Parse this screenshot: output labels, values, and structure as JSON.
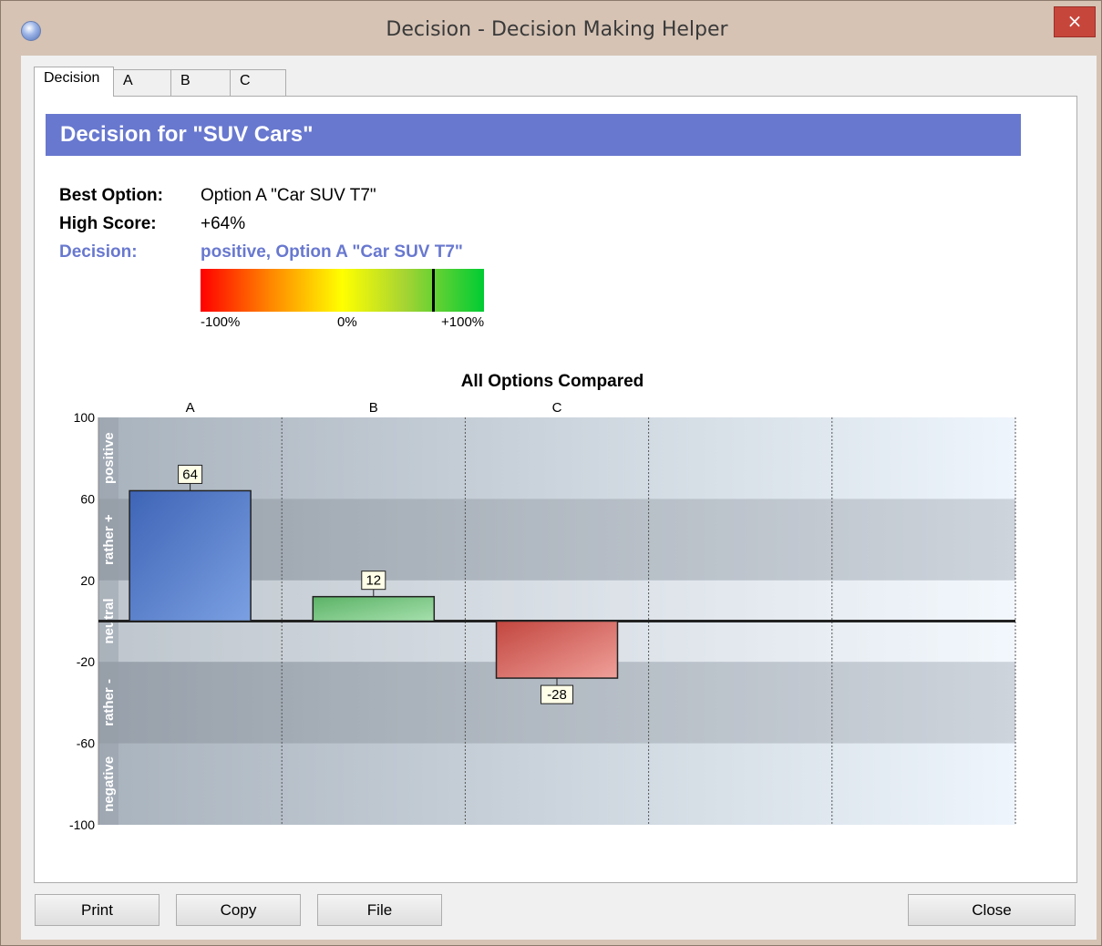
{
  "window": {
    "title": "Decision - Decision Making Helper",
    "close_glyph": "×"
  },
  "tabs": [
    {
      "label": "Decision"
    },
    {
      "label": "A"
    },
    {
      "label": "B"
    },
    {
      "label": "C"
    }
  ],
  "decision": {
    "banner": "Decision for  \"SUV Cars\"",
    "best_option_label": "Best Option:",
    "best_option_value": "Option A \"Car SUV T7\"",
    "high_score_label": "High Score:",
    "high_score_value": "+64%",
    "decision_label": "Decision:",
    "decision_value": "positive, Option A \"Car SUV T7\"",
    "gauge": {
      "value_percent": 64,
      "min_label": "-100%",
      "mid_label": "0%",
      "max_label": "+100%"
    }
  },
  "chart_data": {
    "type": "bar",
    "title": "All Options Compared",
    "categories": [
      "A",
      "B",
      "C"
    ],
    "values": [
      64,
      12,
      -28
    ],
    "data_labels": [
      "64",
      "12",
      "-28"
    ],
    "bar_colors": [
      "#4a72c4",
      "#6cc27a",
      "#d9605a"
    ],
    "ylim": [
      -100,
      100
    ],
    "yticks": [
      "100",
      "60",
      "20",
      "-20",
      "-60",
      "-100"
    ],
    "bands": [
      "positive",
      "rather +",
      "neutral",
      "rather -",
      "negative"
    ],
    "grid": true
  },
  "buttons": {
    "print": "Print",
    "copy": "Copy",
    "file": "File",
    "close": "Close"
  }
}
